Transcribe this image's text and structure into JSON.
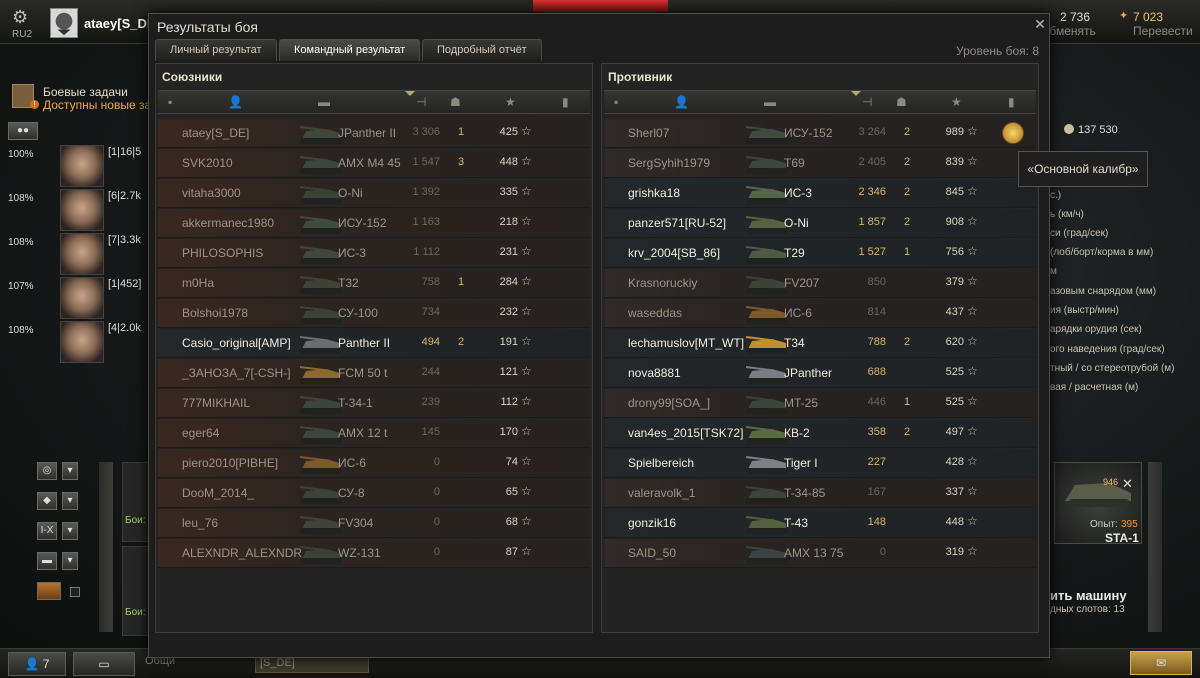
{
  "header": {
    "server": "RU2",
    "player_name": "ataey[S_DE]",
    "gold_amount": "7 023",
    "gold_action": "Перевести",
    "credits_amount": "2 736",
    "credits_action": "Обменять"
  },
  "left_sidebar": {
    "tasks_title": "Боевые задачи",
    "tasks_subtitle": "Доступны новые задачи",
    "crew": [
      {
        "pct": "100%",
        "skills": "[1|16|5"
      },
      {
        "pct": "108%",
        "skills": "[6|2.7k"
      },
      {
        "pct": "108%",
        "skills": "[7|3.3k"
      },
      {
        "pct": "107%",
        "skills": "[1|452]"
      },
      {
        "pct": "108%",
        "skills": "[4|2.0k"
      }
    ],
    "filter_level": "I-X",
    "vehicle_label": "Бои:"
  },
  "dialog": {
    "title": "Результаты боя",
    "tabs": [
      "Личный результат",
      "Командный результат",
      "Подробный отчёт"
    ],
    "active_tab": 1,
    "battle_level": "Уровень боя: 8",
    "allies_title": "Союзники",
    "enemies_title": "Противник",
    "allies": [
      {
        "name": "ataey[S_DE]",
        "tank": "JPanther II",
        "damage": "3 306",
        "kills": "1",
        "xp": "425",
        "alive": false,
        "camo": "#41463f"
      },
      {
        "name": "SVK2010",
        "tank": "AMX M4 45",
        "damage": "1 547",
        "kills": "3",
        "xp": "448",
        "alive": false,
        "camo": "#3e4641"
      },
      {
        "name": "vitaha3000",
        "tank": "O-Ni",
        "damage": "1 392",
        "kills": "",
        "xp": "335",
        "alive": false,
        "camo": "#3a4238"
      },
      {
        "name": "akkermanec1980",
        "tank": "ИСУ-152",
        "damage": "1 163",
        "kills": "",
        "xp": "218",
        "alive": false,
        "camo": "#404a3e"
      },
      {
        "name": "PHILOSOPHIS",
        "tank": "ИС-3",
        "damage": "1 112",
        "kills": "",
        "xp": "231",
        "alive": false,
        "camo": "#3f483c"
      },
      {
        "name": "m0Ha",
        "tank": "T32",
        "damage": "758",
        "kills": "1",
        "xp": "284",
        "alive": false,
        "camo": "#3c4438"
      },
      {
        "name": "Bolshoi1978",
        "tank": "СУ-100",
        "damage": "734",
        "kills": "",
        "xp": "232",
        "alive": false,
        "camo": "#3b4338"
      },
      {
        "name": "Casio_original[AMP]",
        "tank": "Panther II",
        "damage": "494",
        "kills": "2",
        "xp": "191",
        "alive": true,
        "camo": "#6a6e70"
      },
      {
        "name": "_ЗАНОЗА_7[-CSH-]",
        "tank": "FCM 50 t",
        "damage": "244",
        "kills": "",
        "xp": "121",
        "alive": false,
        "camo": "#8a6a2e"
      },
      {
        "name": "777MIKHAIL",
        "tank": "T-34-1",
        "damage": "239",
        "kills": "",
        "xp": "112",
        "alive": false,
        "camo": "#3c4539"
      },
      {
        "name": "eger64",
        "tank": "AMX 12 t",
        "damage": "145",
        "kills": "",
        "xp": "170",
        "alive": false,
        "camo": "#3e4540"
      },
      {
        "name": "piero2010[PIBHE]",
        "tank": "ИС-6",
        "damage": "0",
        "kills": "",
        "xp": "74",
        "alive": false,
        "camo": "#7a5a28"
      },
      {
        "name": "DooM_2014_",
        "tank": "СУ-8",
        "damage": "0",
        "kills": "",
        "xp": "65",
        "alive": false,
        "camo": "#3b4339"
      },
      {
        "name": "leu_76",
        "tank": "FV304",
        "damage": "0",
        "kills": "",
        "xp": "68",
        "alive": false,
        "camo": "#3d453b"
      },
      {
        "name": "ALEXNDR_ALEXNDR",
        "tank": "WZ-131",
        "damage": "0",
        "kills": "",
        "xp": "87",
        "alive": false,
        "camo": "#3a4238"
      }
    ],
    "enemies": [
      {
        "name": "Sherl07",
        "tank": "ИСУ-152",
        "damage": "3 264",
        "kills": "2",
        "xp": "989",
        "alive": false,
        "medal": true,
        "camo": "#404a3e"
      },
      {
        "name": "SergSyhih1979",
        "tank": "T69",
        "damage": "2 405",
        "kills": "2",
        "xp": "839",
        "alive": false,
        "camo": "#3e4641"
      },
      {
        "name": "grishka18",
        "tank": "ИС-3",
        "damage": "2 346",
        "kills": "2",
        "xp": "845",
        "alive": true,
        "camo": "#56644a"
      },
      {
        "name": "panzer571[RU-52]",
        "tank": "O-Ni",
        "damage": "1 857",
        "kills": "2",
        "xp": "908",
        "alive": true,
        "camo": "#55613f"
      },
      {
        "name": "krv_2004[SB_86]",
        "tank": "T29",
        "damage": "1 527",
        "kills": "1",
        "xp": "756",
        "alive": true,
        "camo": "#4e5a46"
      },
      {
        "name": "Krasnoruckiy",
        "tank": "FV207",
        "damage": "850",
        "kills": "",
        "xp": "379",
        "alive": false,
        "camo": "#3c4438"
      },
      {
        "name": "waseddas",
        "tank": "ИС-6",
        "damage": "814",
        "kills": "",
        "xp": "437",
        "alive": false,
        "camo": "#7a5a28"
      },
      {
        "name": "lechamuslov[MT_WT]",
        "tank": "T34",
        "damage": "788",
        "kills": "2",
        "xp": "620",
        "alive": true,
        "camo": "#c48f2e"
      },
      {
        "name": "nova8881",
        "tank": "JPanther",
        "damage": "688",
        "kills": "",
        "xp": "525",
        "alive": true,
        "camo": "#7a7e82"
      },
      {
        "name": "drony99[SOA_]",
        "tank": "MT-25",
        "damage": "446",
        "kills": "1",
        "xp": "525",
        "alive": false,
        "camo": "#3c4539"
      },
      {
        "name": "van4es_2015[TSK72]",
        "tank": "КВ-2",
        "damage": "358",
        "kills": "2",
        "xp": "497",
        "alive": true,
        "camo": "#5c6a44"
      },
      {
        "name": "Spielbereich",
        "tank": "Tiger I",
        "damage": "227",
        "kills": "",
        "xp": "428",
        "alive": true,
        "camo": "#7d8186"
      },
      {
        "name": "valeravolk_1",
        "tank": "T-34-85",
        "damage": "167",
        "kills": "",
        "xp": "337",
        "alive": false,
        "camo": "#3b4339"
      },
      {
        "name": "gonzik16",
        "tank": "T-43",
        "damage": "148",
        "kills": "",
        "xp": "448",
        "alive": true,
        "camo": "#53603f"
      },
      {
        "name": "SAID_50",
        "tank": "AMX 13 75",
        "damage": "0",
        "kills": "",
        "xp": "319",
        "alive": false,
        "camo": "#3a4543"
      }
    ],
    "tooltip": "«Основной калибр»"
  },
  "right_panel": {
    "credits_value": "137 530",
    "stats": [
      "с.)",
      "ь (км/ч)",
      "си (град/сек)",
      "(лоб/борт/корма в мм)",
      "м",
      "азовым снарядом (мм)",
      "ия (выстр/мин)",
      "арядки орудия (сек)",
      "ого наведения (град/сек)",
      "тный / со стереотрубой (м)",
      "вая / расчетная (м)"
    ],
    "vehicle_badge": "946",
    "vehicle_xp_label": "Опыт:",
    "vehicle_xp_value": "395",
    "vehicle_name": "STA-1",
    "buy_title": "ить машину",
    "buy_slots": "дных слотов: 13"
  },
  "bottom": {
    "friends_count": "7",
    "chat_placeholder": "Общи",
    "clan_tag": "[S_DE]"
  }
}
